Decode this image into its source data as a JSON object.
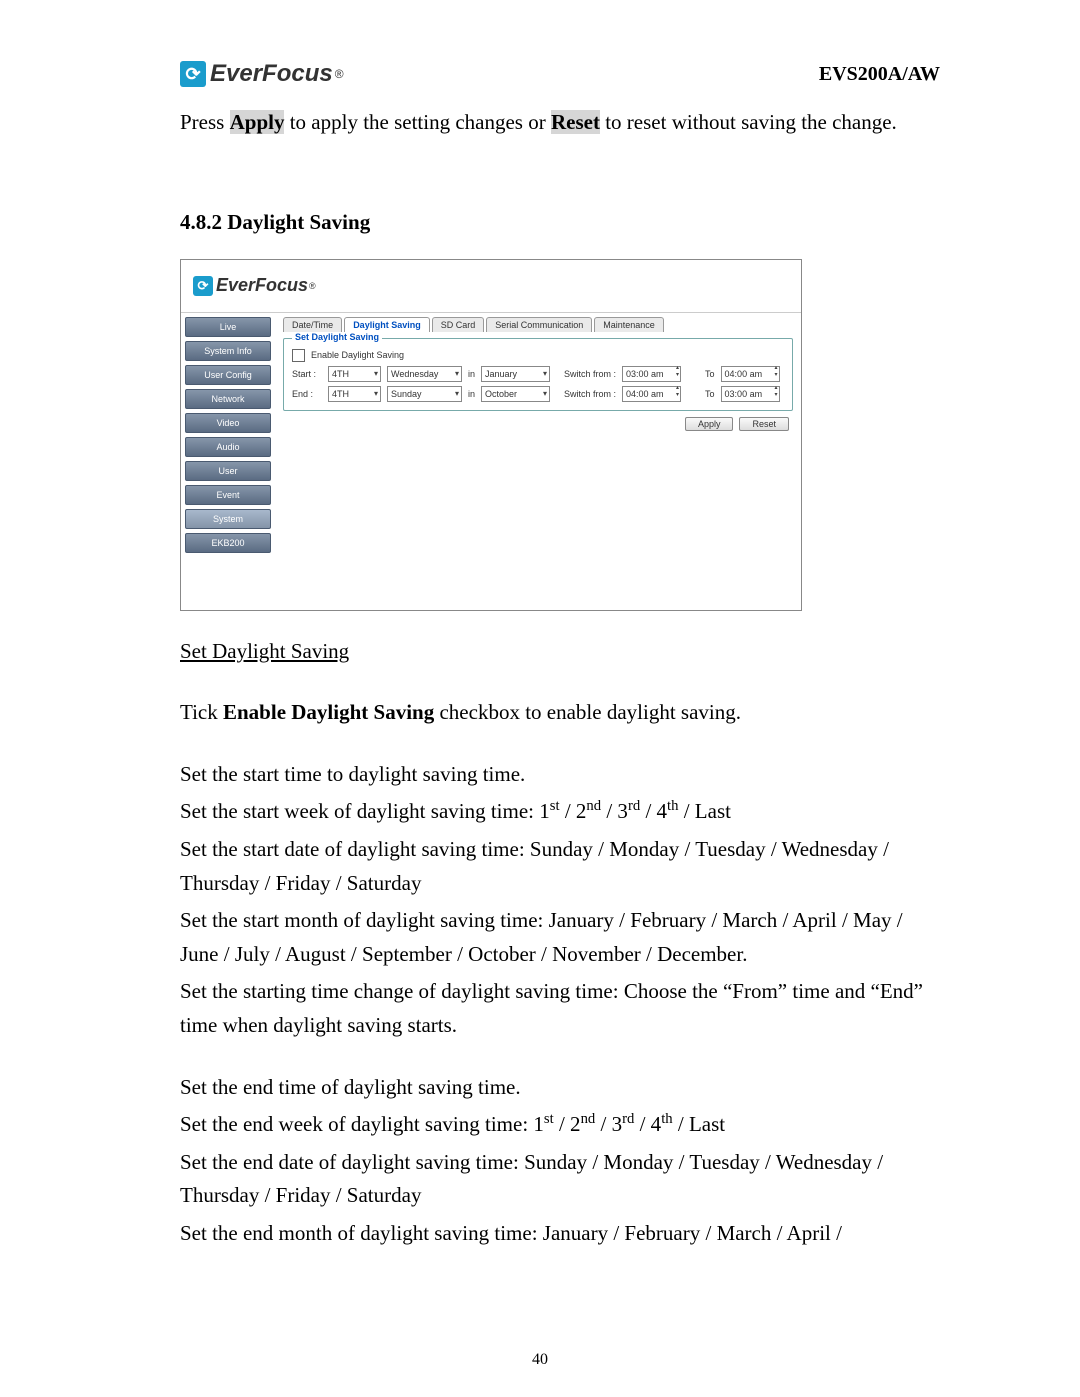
{
  "header": {
    "logo_text": "EverFocus",
    "model": "EVS200A/AW"
  },
  "intro": {
    "press": "Press ",
    "apply": "Apply",
    "mid1": " to apply the setting changes or ",
    "reset": "Reset",
    "mid2": " to reset without saving the change."
  },
  "section_number": "4.8.2 ",
  "section_title": "Daylight Saving",
  "screenshot": {
    "logo_text": "EverFocus",
    "sidebar": [
      "Live",
      "System Info",
      "User Config",
      "Network",
      "Video",
      "Audio",
      "User",
      "Event",
      "System",
      "EKB200"
    ],
    "tabs": [
      "Date/Time",
      "Daylight Saving",
      "SD Card",
      "Serial Communication",
      "Maintenance"
    ],
    "active_tab_index": 1,
    "fieldset_legend": "Set Daylight Saving",
    "enable_label": "Enable Daylight Saving",
    "start": {
      "label": "Start :",
      "week": "4TH",
      "day": "Wednesday",
      "in": "in",
      "month": "January",
      "switch_label": "Switch from :",
      "from_time": "03:00 am",
      "to_label": "To",
      "to_time": "04:00 am"
    },
    "end": {
      "label": "End :",
      "week": "4TH",
      "day": "Sunday",
      "in": "in",
      "month": "October",
      "switch_label": "Switch from :",
      "from_time": "04:00 am",
      "to_label": "To",
      "to_time": "03:00 am"
    },
    "buttons": {
      "apply": "Apply",
      "reset": "Reset"
    }
  },
  "body": {
    "sds_heading": "Set Daylight Saving",
    "tick_pre": "Tick ",
    "tick_bold": "Enable Daylight Saving",
    "tick_post": " checkbox to enable daylight saving.",
    "p_start1": "Set the start time to daylight saving time.",
    "p_start2a": "Set the start week of daylight saving time: 1",
    "p_start2b": " / 2",
    "p_start2c": " / 3",
    "p_start2d": " / 4",
    "p_start2e": " / Last",
    "sup_st": "st",
    "sup_nd": "nd",
    "sup_rd": "rd",
    "sup_th": "th",
    "p_start3": "Set the start date of daylight saving time: Sunday / Monday / Tuesday / Wednesday / Thursday / Friday / Saturday",
    "p_start4": "Set the start month of daylight saving time: January / February / March / April / May / June / July / August / September / October / November / December.",
    "p_start5": "Set the starting time change of daylight saving time: Choose the “From” time and “End” time when daylight saving starts.",
    "p_end1": "Set the end time of daylight saving time.",
    "p_end2a": "Set the end week of daylight saving time: 1",
    "p_end3": "Set the end date of daylight saving time:  Sunday / Monday / Tuesday / Wednesday / Thursday / Friday / Saturday",
    "p_end4": "Set the end month of daylight saving time: January / February / March / April /"
  },
  "page_number": "40"
}
